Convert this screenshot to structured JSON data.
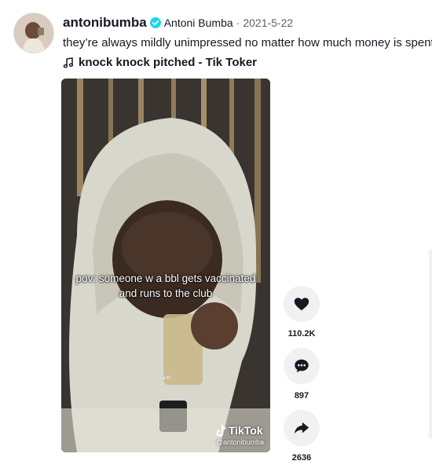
{
  "post": {
    "username": "antonibumba",
    "nickname": "Antoni Bumba",
    "separator": "·",
    "date": "2021-5-22",
    "description": "they’re always mildly unimpressed no matter how much money is spent",
    "music": "knock knock pitched - Tik Toker"
  },
  "video": {
    "caption": "pov: someone w a bbl gets vaccinated and runs to the club",
    "watermark_brand": "TikTok",
    "watermark_handle": "@antonibumba"
  },
  "actions": {
    "likes": "110.2K",
    "comments": "897",
    "shares": "2636"
  },
  "icons": {
    "verified": "verified-badge-icon",
    "music": "music-note-icon",
    "like": "heart-icon",
    "comment": "comment-icon",
    "share": "share-icon"
  },
  "colors": {
    "verified": "#20d5ec",
    "text": "#161823",
    "secondary": "#5e5f66",
    "action_bg": "#f1f1f2"
  }
}
